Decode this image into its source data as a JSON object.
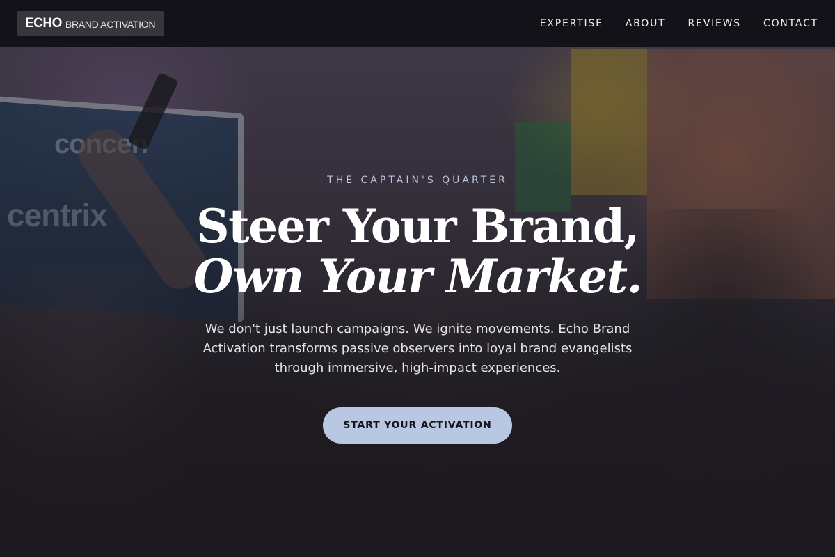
{
  "nav": {
    "logo_main": "ECHO",
    "logo_sub": "BRAND ACTIVATION",
    "links": [
      "EXPERTISE",
      "ABOUT",
      "REVIEWS",
      "CONTACT"
    ]
  },
  "hero": {
    "eyebrow": "THE CAPTAIN'S QUARTER",
    "headline_line1": "Steer Your Brand,",
    "headline_line2": "Own Your Market.",
    "subtext": "We don't just launch campaigns. We ignite movements. Echo Brand Activation transforms passive observers into loyal brand evangelists through immersive, high-impact experiences.",
    "cta_label": "START YOUR ACTIVATION"
  },
  "background": {
    "booth_text_top": "concen",
    "booth_text_bottom": "centrix"
  },
  "colors": {
    "nav_bg": "#100e14",
    "logo_bg": "#38363c",
    "eyebrow": "#b9c3d9",
    "cta_bg": "#b8c7e2",
    "cta_text": "#17161b",
    "page_bg": "#1c1a1f"
  }
}
